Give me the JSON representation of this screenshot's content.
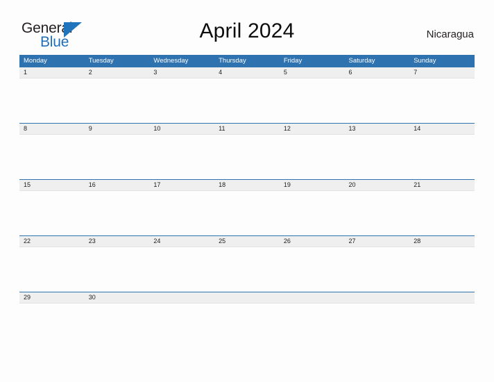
{
  "brand": {
    "name_top": "General",
    "name_bottom": "Blue",
    "flag_icon": "blue-triangle-flag-icon",
    "accent_color": "#1f6fb8"
  },
  "header": {
    "title": "April 2024",
    "region": "Nicaragua"
  },
  "calendar": {
    "header_color": "#2e72b0",
    "date_band_color": "#efefef",
    "weekdays": [
      "Monday",
      "Tuesday",
      "Wednesday",
      "Thursday",
      "Friday",
      "Saturday",
      "Sunday"
    ],
    "weeks": [
      {
        "days": [
          {
            "date": "1",
            "events": ""
          },
          {
            "date": "2",
            "events": ""
          },
          {
            "date": "3",
            "events": ""
          },
          {
            "date": "4",
            "events": ""
          },
          {
            "date": "5",
            "events": ""
          },
          {
            "date": "6",
            "events": ""
          },
          {
            "date": "7",
            "events": ""
          }
        ]
      },
      {
        "days": [
          {
            "date": "8",
            "events": ""
          },
          {
            "date": "9",
            "events": ""
          },
          {
            "date": "10",
            "events": ""
          },
          {
            "date": "11",
            "events": ""
          },
          {
            "date": "12",
            "events": ""
          },
          {
            "date": "13",
            "events": ""
          },
          {
            "date": "14",
            "events": ""
          }
        ]
      },
      {
        "days": [
          {
            "date": "15",
            "events": ""
          },
          {
            "date": "16",
            "events": ""
          },
          {
            "date": "17",
            "events": ""
          },
          {
            "date": "18",
            "events": ""
          },
          {
            "date": "19",
            "events": ""
          },
          {
            "date": "20",
            "events": ""
          },
          {
            "date": "21",
            "events": ""
          }
        ]
      },
      {
        "days": [
          {
            "date": "22",
            "events": ""
          },
          {
            "date": "23",
            "events": ""
          },
          {
            "date": "24",
            "events": ""
          },
          {
            "date": "25",
            "events": ""
          },
          {
            "date": "26",
            "events": ""
          },
          {
            "date": "27",
            "events": ""
          },
          {
            "date": "28",
            "events": ""
          }
        ]
      },
      {
        "days": [
          {
            "date": "29",
            "events": ""
          },
          {
            "date": "30",
            "events": ""
          },
          {
            "date": "",
            "events": ""
          },
          {
            "date": "",
            "events": ""
          },
          {
            "date": "",
            "events": ""
          },
          {
            "date": "",
            "events": ""
          },
          {
            "date": "",
            "events": ""
          }
        ]
      }
    ]
  }
}
